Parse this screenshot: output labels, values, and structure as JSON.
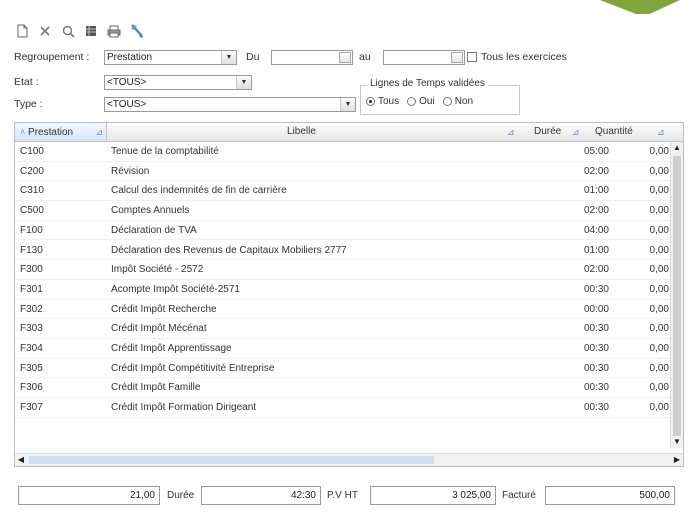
{
  "toolbar": {
    "icons": [
      "new-icon",
      "delete-icon",
      "search-icon",
      "grid-icon",
      "print-icon",
      "tools-icon"
    ]
  },
  "filters": {
    "regroupement_label": "Regroupement :",
    "regroupement_value": "Prestation",
    "du_label": "Du",
    "du_value": "",
    "au_label": "au",
    "au_value": "",
    "tous_exercices_label": "Tous les exercices",
    "etat_label": "Etat :",
    "etat_value": "<TOUS>",
    "type_label": "Type :",
    "type_value": "<TOUS>",
    "lignes_group_title": "Lignes de Temps validées",
    "radio_tous": "Tous",
    "radio_oui": "Oui",
    "radio_non": "Non",
    "radio_selected": "Tous"
  },
  "grid": {
    "columns": [
      "Prestation",
      "Libelle",
      "Durée",
      "Quantité"
    ],
    "rows": [
      {
        "code": "C100",
        "libelle": "Tenue de la comptabilité",
        "duree": "05:00",
        "quantite": "0,00"
      },
      {
        "code": "C200",
        "libelle": "Révision",
        "duree": "02:00",
        "quantite": "0,00"
      },
      {
        "code": "C310",
        "libelle": "Calcul des indemnités de fin de carrière",
        "duree": "01:00",
        "quantite": "0,00"
      },
      {
        "code": "C500",
        "libelle": "Comptes Annuels",
        "duree": "02:00",
        "quantite": "0,00"
      },
      {
        "code": "F100",
        "libelle": "Déclaration de TVA",
        "duree": "04:00",
        "quantite": "0,00"
      },
      {
        "code": "F130",
        "libelle": "Déclaration des Revenus de Capitaux Mobiliers 2777",
        "duree": "01:00",
        "quantite": "0,00"
      },
      {
        "code": "F300",
        "libelle": "Impôt Société - 2572",
        "duree": "02:00",
        "quantite": "0,00"
      },
      {
        "code": "F301",
        "libelle": "Acompte Impôt Société-2571",
        "duree": "00:30",
        "quantite": "0,00"
      },
      {
        "code": "F302",
        "libelle": "Crédit Impôt Recherche",
        "duree": "00:00",
        "quantite": "0,00"
      },
      {
        "code": "F303",
        "libelle": "Crédit Impôt Mécénat",
        "duree": "00:30",
        "quantite": "0,00"
      },
      {
        "code": "F304",
        "libelle": "Crédit Impôt Apprentissage",
        "duree": "00:30",
        "quantite": "0,00"
      },
      {
        "code": "F305",
        "libelle": "Crédit Impôt Compétitivité Entreprise",
        "duree": "00:30",
        "quantite": "0,00"
      },
      {
        "code": "F306",
        "libelle": "Crédit Impôt Famille",
        "duree": "00:30",
        "quantite": "0,00"
      },
      {
        "code": "F307",
        "libelle": "Crédit Impôt Formation Dirigeant",
        "duree": "00:30",
        "quantite": "0,00"
      }
    ]
  },
  "footer": {
    "first_value": "21,00",
    "duree_label": "Durée",
    "duree_value": "42:30",
    "pvht_label": "P.V HT",
    "pvht_value": "3 025,00",
    "facture_label": "Facturé",
    "facture_value": "500,00"
  },
  "colors": {
    "accent_arrow": "#7fa63a",
    "header_selected": "#d6e6f7",
    "pin_icon": "#5a8fd0"
  }
}
